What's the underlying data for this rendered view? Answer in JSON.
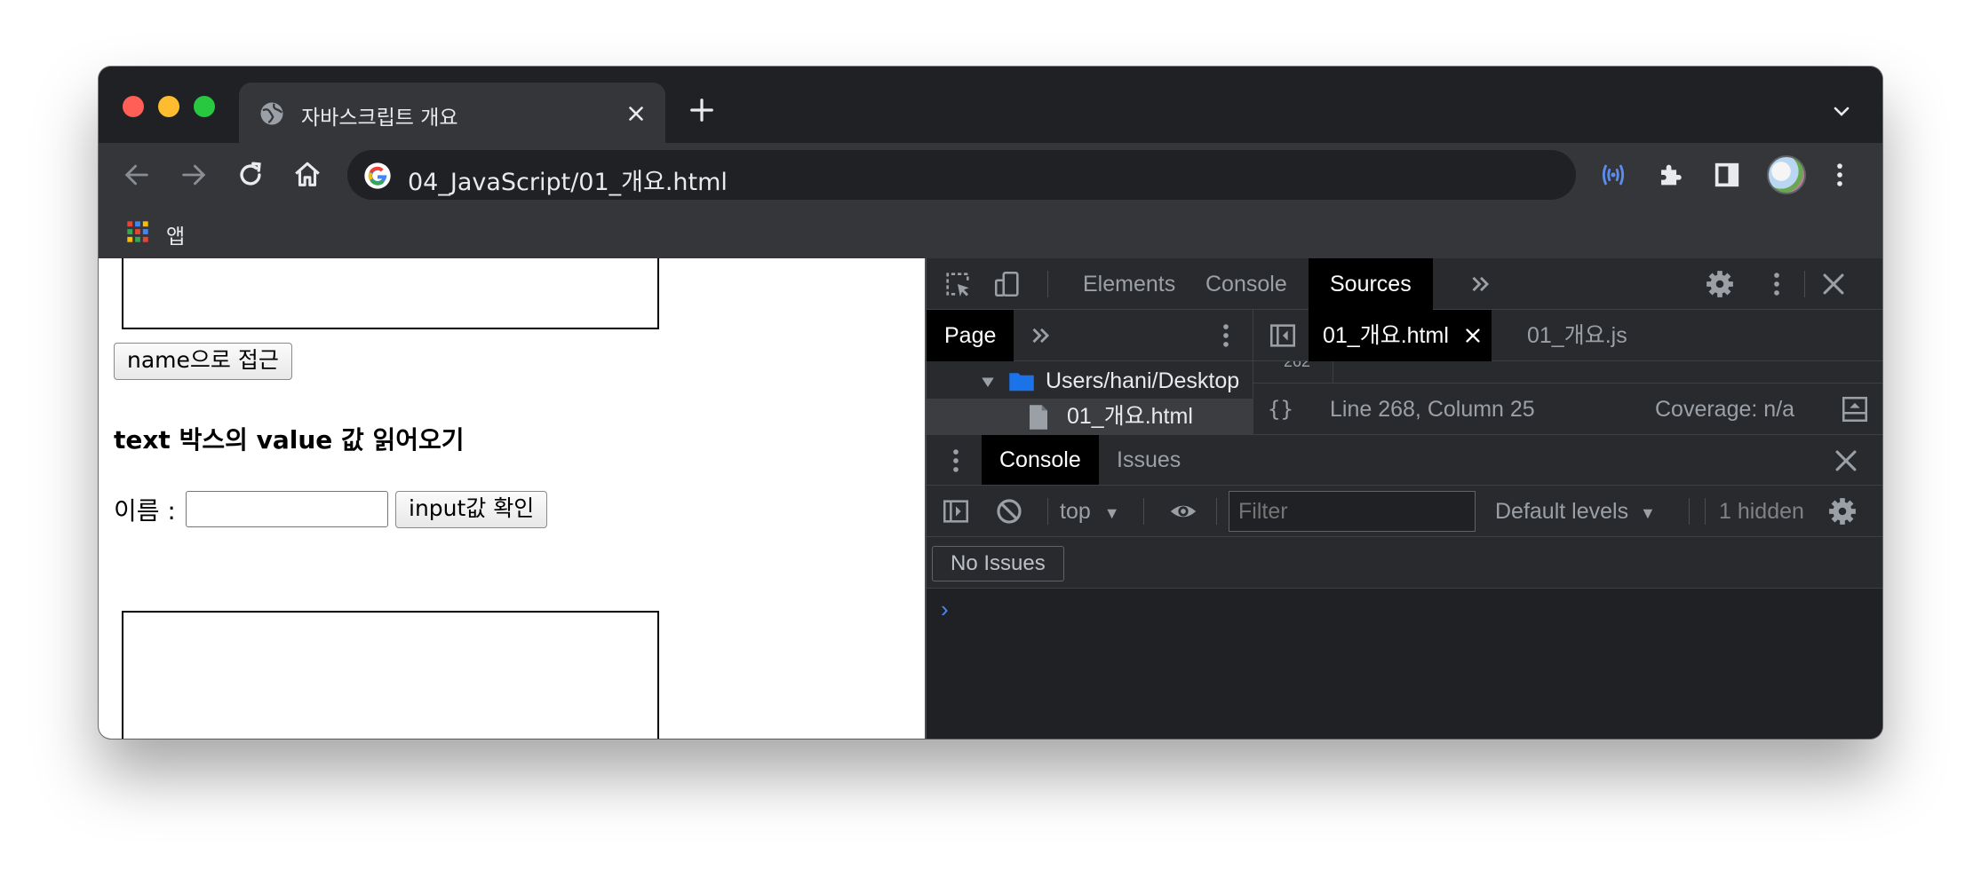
{
  "browser": {
    "tab_title": "자바스크립트 개요",
    "url": "04_JavaScript/01_개요.html",
    "bookmarks_apps_label": "앱"
  },
  "page": {
    "name_access_button": "name으로 접근",
    "section_heading": "text 박스의 value 값 읽어오기",
    "name_label": "이름 :",
    "name_input_value": "",
    "input_check_button": "input값 확인"
  },
  "devtools": {
    "tabs": [
      "Elements",
      "Console",
      "Sources"
    ],
    "active_tab": "Sources",
    "navigator": {
      "tab": "Page",
      "folder": "Users/hani/Desktop",
      "file": "01_개요.html"
    },
    "editor": {
      "tabs": [
        "01_개요.html",
        "01_개요.js"
      ],
      "gutter_partial": "262",
      "position": "Line 268, Column 25",
      "coverage": "Coverage: n/a"
    },
    "drawer": {
      "tabs": [
        "Console",
        "Issues"
      ],
      "context": "top",
      "filter_placeholder": "Filter",
      "levels": "Default levels",
      "hidden": "1 hidden",
      "no_issues": "No Issues",
      "prompt": "›"
    }
  },
  "colors": {
    "chrome_dark": "#202124",
    "toolbar": "#35363a",
    "devtools_bg": "#292a2d",
    "active_tab": "#000000",
    "prompt_blue": "#4a8af4",
    "folder_blue": "#1a73e8"
  }
}
